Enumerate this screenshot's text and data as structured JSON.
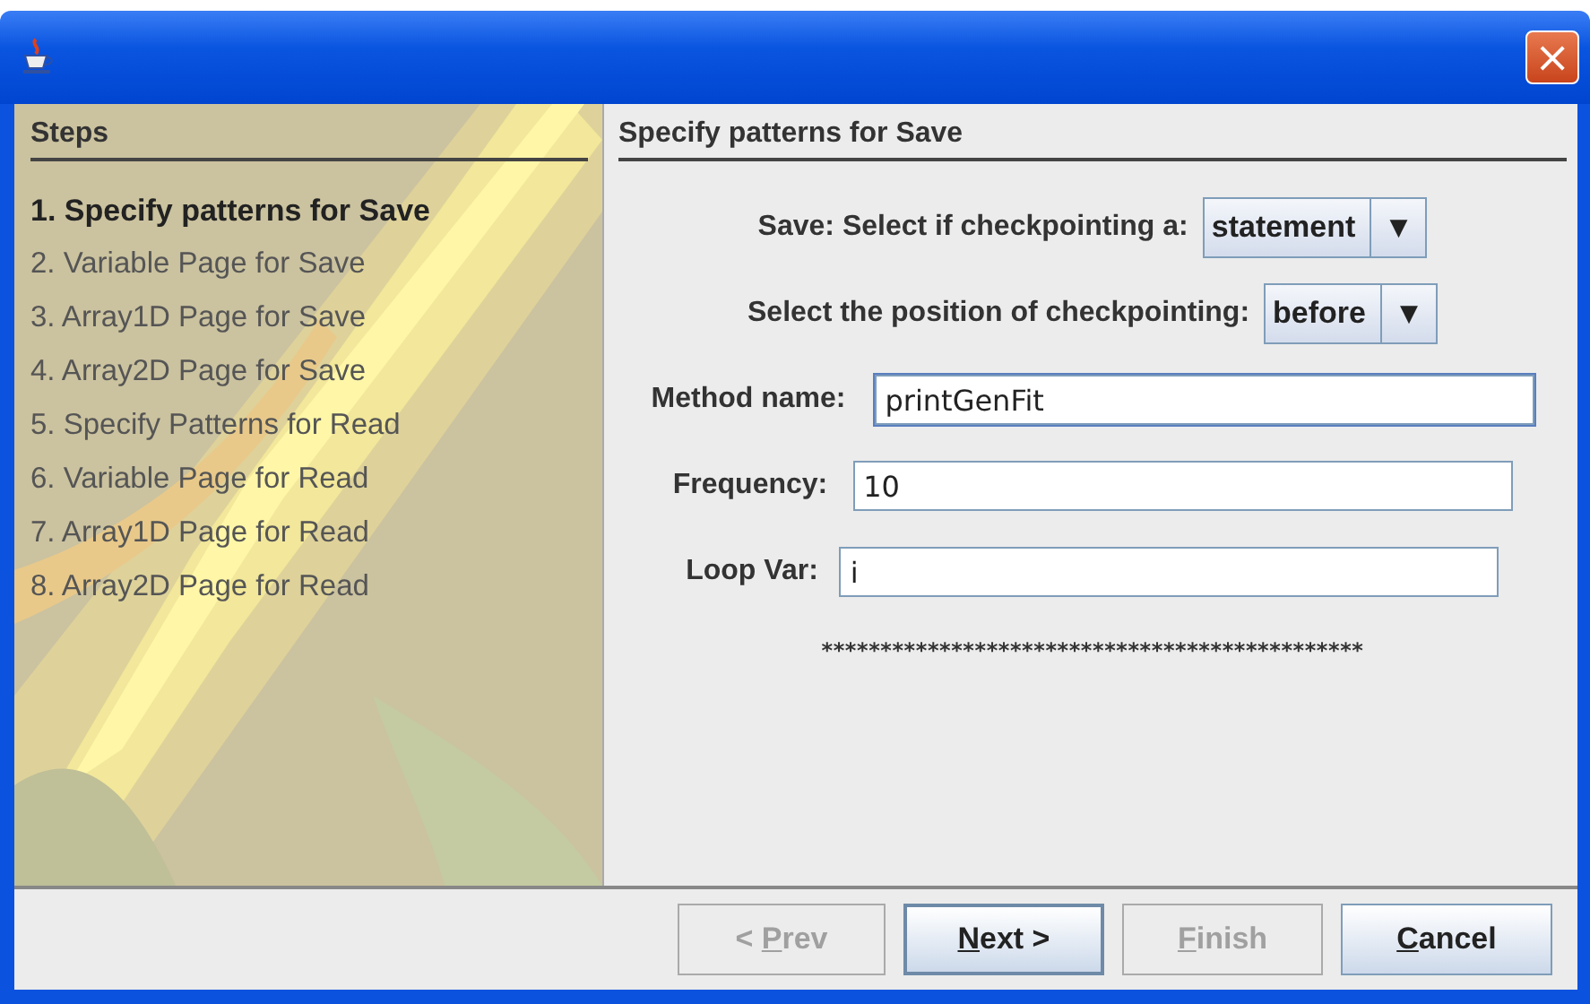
{
  "window": {
    "close": "×"
  },
  "steps": {
    "title": "Steps",
    "items": [
      {
        "label": "1. Specify patterns for Save",
        "selected": true
      },
      {
        "label": "2. Variable Page for Save",
        "selected": false
      },
      {
        "label": "3. Array1D Page for Save",
        "selected": false
      },
      {
        "label": "4. Array2D Page for Save",
        "selected": false
      },
      {
        "label": "5. Specify Patterns for Read",
        "selected": false
      },
      {
        "label": "6. Variable Page for Read",
        "selected": false
      },
      {
        "label": "7. Array1D Page for Read",
        "selected": false
      },
      {
        "label": "8. Array2D Page for Read",
        "selected": false
      }
    ]
  },
  "content": {
    "title": "Specify patterns for Save",
    "rows": [
      {
        "kind": "combo",
        "label": "Save: Select if checkpointing a:",
        "value": "statement",
        "arrow": "▼"
      },
      {
        "kind": "combo",
        "label": "Select the position of checkpointing:",
        "value": "before",
        "arrow": "▼"
      },
      {
        "kind": "field",
        "label": "Method name:",
        "value": "printGenFit",
        "focused": true
      },
      {
        "kind": "field",
        "label": "Frequency:",
        "value": "10",
        "focused": false
      },
      {
        "kind": "field",
        "label": "Loop Var:",
        "value": "i",
        "focused": false
      }
    ],
    "separator": "**********************************************"
  },
  "buttons": [
    {
      "before": "< ",
      "mnemonic": "P",
      "after": "rev",
      "disabled": true,
      "default": false
    },
    {
      "mnemonic": "N",
      "after": "ext >",
      "disabled": false,
      "default": true
    },
    {
      "mnemonic": "F",
      "after": "inish",
      "disabled": true,
      "default": false
    },
    {
      "mnemonic": "C",
      "after": "ancel",
      "disabled": false,
      "default": false
    }
  ]
}
